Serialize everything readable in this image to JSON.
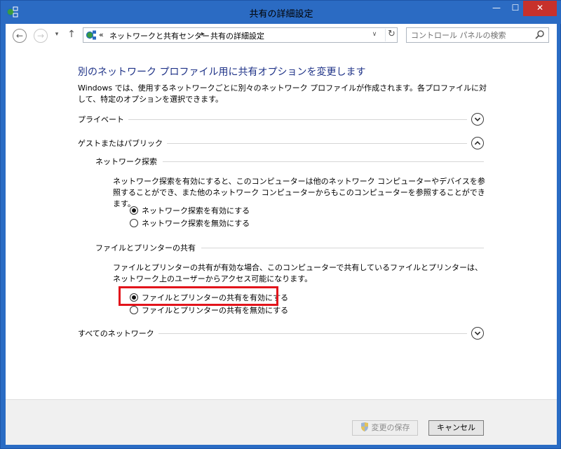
{
  "window": {
    "title": "共有の詳細設定",
    "controls": {
      "minimize": "—",
      "maximize": "☐",
      "close": "✕"
    }
  },
  "navbar": {
    "back_glyph": "←",
    "forward_glyph": "→",
    "recent_glyph": "▾",
    "up_glyph": "↑",
    "address": {
      "prefix": "«",
      "crumbs": [
        "ネットワークと共有センター",
        "共有の詳細設定"
      ],
      "separator": "▸",
      "dropdown_glyph": "∨",
      "refresh_glyph": "↻"
    },
    "search": {
      "placeholder": "コントロール パネルの検索",
      "icon": "search-icon"
    }
  },
  "main": {
    "heading": "別のネットワーク プロファイル用に共有オプションを変更します",
    "description": "Windows では、使用するネットワークごとに別々のネットワーク プロファイルが作成されます。各プロファイルに対して、特定のオプションを選択できます。",
    "sections": [
      {
        "label": "プライベート",
        "expanded": false
      },
      {
        "label": "ゲストまたはパブリック",
        "expanded": true
      },
      {
        "label": "すべてのネットワーク",
        "expanded": false
      }
    ],
    "network_discovery": {
      "label": "ネットワーク探索",
      "description": "ネットワーク探索を有効にすると、このコンピューターは他のネットワーク コンピューターやデバイスを参照することができ、また他のネットワーク コンピューターからもこのコンピューターを参照することができます。",
      "options": [
        {
          "label": "ネットワーク探索を有効にする",
          "checked": true
        },
        {
          "label": "ネットワーク探索を無効にする",
          "checked": false
        }
      ]
    },
    "file_printer_sharing": {
      "label": "ファイルとプリンターの共有",
      "description": "ファイルとプリンターの共有が有効な場合、このコンピューターで共有しているファイルとプリンターは、ネットワーク上のユーザーからアクセス可能になります。",
      "options": [
        {
          "label": "ファイルとプリンターの共有を有効にする",
          "checked": true
        },
        {
          "label": "ファイルとプリンターの共有を無効にする",
          "checked": false
        }
      ]
    }
  },
  "footer": {
    "save_label": "変更の保存",
    "cancel_label": "キャンセル"
  },
  "colors": {
    "titlebar": "#2b6bc3",
    "heading": "#1e3287",
    "highlight": "#e2141b",
    "close_button": "#c7312b"
  }
}
